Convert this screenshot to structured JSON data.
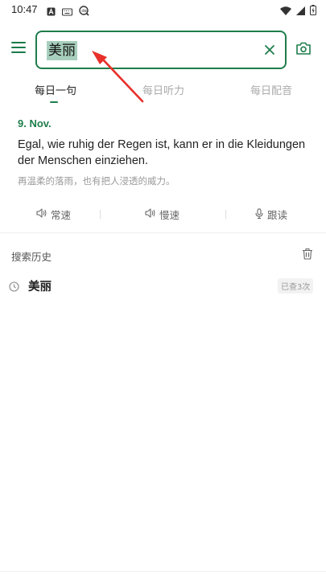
{
  "status_bar": {
    "time": "10:47",
    "left_icons": [
      "notification-a-icon",
      "keyboard-icon",
      "translate-app-icon"
    ],
    "right_icons": [
      "wifi-icon",
      "signal-icon",
      "battery-icon"
    ]
  },
  "header": {
    "menu_icon": "menu-icon",
    "search_query": "美丽",
    "clear_icon": "close-icon",
    "camera_icon": "camera-icon"
  },
  "tabs": [
    {
      "label": "每日一句",
      "active": true
    },
    {
      "label": "每日听力",
      "active": false
    },
    {
      "label": "每日配音",
      "active": false
    }
  ],
  "daily": {
    "date": "9. Nov.",
    "sentence": "Egal, wie ruhig der Regen ist, kann er in die Kleidungen der Menschen einziehen.",
    "translation": "再温柔的落雨，也有把人浸透的威力。"
  },
  "actions": [
    {
      "label": "常速",
      "icon": "speaker-icon"
    },
    {
      "label": "慢速",
      "icon": "speaker-icon"
    },
    {
      "label": "跟读",
      "icon": "microphone-icon"
    }
  ],
  "history": {
    "title": "搜索历史",
    "clear_icon": "trash-icon",
    "items": [
      {
        "word": "美丽",
        "badge": "已查3次"
      }
    ]
  },
  "colors": {
    "accent": "#1e7d4b",
    "selection": "#a8cfbd",
    "annotation_arrow": "#e8302a"
  }
}
